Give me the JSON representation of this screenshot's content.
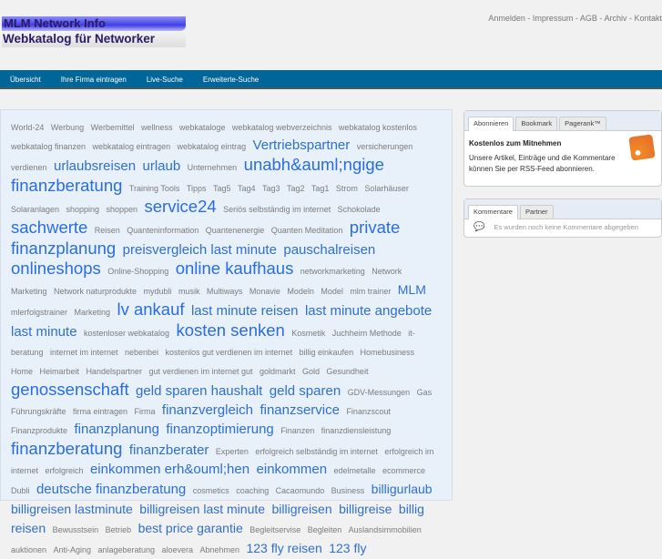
{
  "logo": {
    "line1": "MLM Network Info",
    "line2": "Webkatalog für Networker"
  },
  "toplinks": [
    "Anmelden",
    "Impressum",
    "AGB",
    "Archiv",
    "Kontakt"
  ],
  "nav": [
    "Übersicht",
    "Ihre Firma eintragen",
    "Live-Suche",
    "Erweiterte-Suche"
  ],
  "tags": [
    [
      "World-24",
      1
    ],
    [
      "Werbung",
      1
    ],
    [
      "Werbemittel",
      1
    ],
    [
      "wellness",
      1
    ],
    [
      "webkataloge",
      1
    ],
    [
      "webkatalog webverzeichnis",
      1
    ],
    [
      "webkatalog kostenlos",
      1
    ],
    [
      "webkatalog finanzen",
      1
    ],
    [
      "webkatalog eintragen",
      1
    ],
    [
      "webkatalog eintrag",
      1
    ],
    [
      "Vertriebspartner",
      3
    ],
    [
      "versicherungen verdienen",
      1
    ],
    [
      "urlaubsreisen",
      3
    ],
    [
      "urlaub",
      3
    ],
    [
      "Unternehmen",
      1
    ],
    [
      "unabh&auml;ngige finanzberatung",
      4
    ],
    [
      "Training Tools",
      1
    ],
    [
      "Tipps",
      1
    ],
    [
      "Tag5",
      1
    ],
    [
      "Tag4",
      1
    ],
    [
      "Tag3",
      1
    ],
    [
      "Tag2",
      1
    ],
    [
      "Tag1",
      1
    ],
    [
      "Strom",
      1
    ],
    [
      "Solarhäuser",
      1
    ],
    [
      "Solaranlagen",
      1
    ],
    [
      "shopping",
      1
    ],
    [
      "shoppen",
      1
    ],
    [
      "service24",
      4
    ],
    [
      "Seriös selbständig im internet",
      1
    ],
    [
      "Schokolade",
      1
    ],
    [
      "sachwerte",
      4
    ],
    [
      "Reisen",
      1
    ],
    [
      "Quanteninformation",
      1
    ],
    [
      "Quantenenergie",
      1
    ],
    [
      "Quanten Meditation",
      1
    ],
    [
      "private finanzplanung",
      4
    ],
    [
      "preisvergleich last minute",
      3
    ],
    [
      "pauschalreisen",
      3
    ],
    [
      "onlineshops",
      4
    ],
    [
      "Online-Shopping",
      1
    ],
    [
      "online kaufhaus",
      4
    ],
    [
      "networkmarketing",
      1
    ],
    [
      "Network Marketing",
      1
    ],
    [
      "Network naturprodukte",
      1
    ],
    [
      "mydubli",
      1
    ],
    [
      "musik",
      1
    ],
    [
      "Multiways",
      1
    ],
    [
      "Monavie",
      1
    ],
    [
      "Modeln",
      1
    ],
    [
      "Model",
      1
    ],
    [
      "mlm trainer",
      1
    ],
    [
      "MLM",
      2
    ],
    [
      "mlerfolgstrainer",
      1
    ],
    [
      "Marketing",
      1
    ],
    [
      "lv ankauf",
      4
    ],
    [
      "last minute reisen",
      3
    ],
    [
      "last minute angebote",
      3
    ],
    [
      "last minute",
      3
    ],
    [
      "kostenloser webkatalog",
      1
    ],
    [
      "kosten senken",
      4
    ],
    [
      "Kosmetik",
      1
    ],
    [
      "Juchheim Methode",
      1
    ],
    [
      "it-beratung",
      1
    ],
    [
      "internet im internet",
      1
    ],
    [
      "nebenbei",
      1
    ],
    [
      "kostenlos gut verdienen im internet",
      1
    ],
    [
      "billig einkaufen",
      1
    ],
    [
      "Homebusiness",
      1
    ],
    [
      "Home",
      1
    ],
    [
      "Heimarbeit",
      1
    ],
    [
      "Handelspartner",
      1
    ],
    [
      "gut verdienen im internet gut",
      1
    ],
    [
      "goldmarkt",
      1
    ],
    [
      "Gold",
      1
    ],
    [
      "Gesundheit",
      1
    ],
    [
      "genossenschaft",
      4
    ],
    [
      "geld sparen haushalt",
      3
    ],
    [
      "geld sparen",
      3
    ],
    [
      "GDV-Messungen",
      1
    ],
    [
      "Gas",
      1
    ],
    [
      "Führungskräfte",
      1
    ],
    [
      "firma eintragen",
      1
    ],
    [
      "Firma",
      1
    ],
    [
      "finanzvergleich",
      3
    ],
    [
      "finanzservice",
      3
    ],
    [
      "Finanzscout",
      1
    ],
    [
      "Finanzprodukte",
      1
    ],
    [
      "finanzplanung",
      3
    ],
    [
      "finanzoptimierung",
      3
    ],
    [
      "Finanzen",
      1
    ],
    [
      "finanzdiensleistung",
      1
    ],
    [
      "finanzberatung",
      4
    ],
    [
      "finanzberater",
      3
    ],
    [
      "Experten",
      1
    ],
    [
      "erfolgreich selbständig im internet",
      1
    ],
    [
      "erfolgreich im internet",
      1
    ],
    [
      "erfolgreich",
      1
    ],
    [
      "einkommen erh&ouml;hen",
      3
    ],
    [
      "einkommen",
      3
    ],
    [
      "edelmetalle",
      1
    ],
    [
      "ecommerce",
      1
    ],
    [
      "Dubli",
      1
    ],
    [
      "deutsche finanzberatung",
      3
    ],
    [
      "cosmetics",
      1
    ],
    [
      "coaching",
      1
    ],
    [
      "Cacaomundo",
      1
    ],
    [
      "Business",
      1
    ],
    [
      "billigurlaub",
      2
    ],
    [
      "billigreisen lastminute",
      2
    ],
    [
      "billigreisen last minute",
      2
    ],
    [
      "billigreisen",
      2
    ],
    [
      "billigreise",
      2
    ],
    [
      "billig reisen",
      2
    ],
    [
      "Bewusstsein",
      1
    ],
    [
      "Betrieb",
      1
    ],
    [
      "best price garantie",
      2
    ],
    [
      "Begleitservise",
      1
    ],
    [
      "Begleiten",
      1
    ],
    [
      "Auslandsimmobilien",
      1
    ],
    [
      "auktionen",
      1
    ],
    [
      "Anti-Aging",
      1
    ],
    [
      "anlageberatung",
      1
    ],
    [
      "aloevera",
      1
    ],
    [
      "Abnehmen",
      1
    ],
    [
      "123 fly reisen",
      2
    ],
    [
      "123 fly",
      2
    ]
  ],
  "subscribe": {
    "tabs": [
      "Abonnieren",
      "Bookmark",
      "Pagerank™"
    ],
    "title": "Kostenlos zum Mitnehmen",
    "text": "Unsere Artikel, Einträge und die Kommentare können Sie per RSS-Feed abonnieren."
  },
  "comments": {
    "tabs": [
      "Kommentare",
      "Partner"
    ],
    "empty": "Es wurden noch keine Kommentare abgegeben"
  }
}
